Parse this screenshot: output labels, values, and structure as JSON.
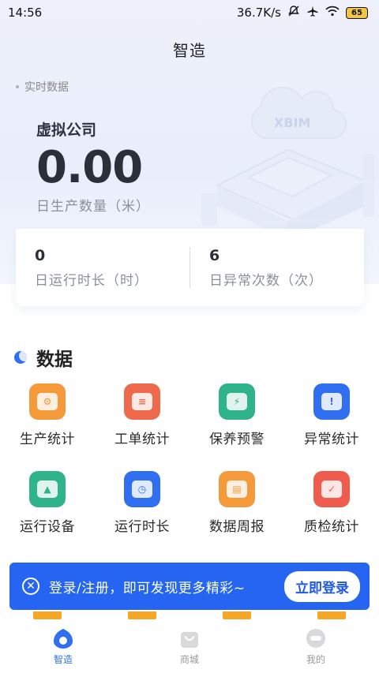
{
  "status_bar": {
    "time": "14:56",
    "network_speed": "36.7K/s",
    "battery": "65"
  },
  "header": {
    "title": "智造"
  },
  "realtime": {
    "section_label": "实时数据",
    "company": "虚拟公司",
    "daily_output_value": "0.00",
    "daily_output_label": "日生产数量（米）",
    "stats": [
      {
        "value": "0",
        "label": "日运行时长（时）"
      },
      {
        "value": "6",
        "label": "日异常次数（次）"
      }
    ],
    "deco_text": "XBIM"
  },
  "data_section": {
    "title": "数据",
    "items": [
      {
        "label": "生产统计",
        "icon": "production-stats-icon",
        "color": "#f59a3b"
      },
      {
        "label": "工单统计",
        "icon": "work-order-icon",
        "color": "#ef6a4c"
      },
      {
        "label": "保养预警",
        "icon": "maintenance-warning-icon",
        "color": "#2fb388"
      },
      {
        "label": "异常统计",
        "icon": "anomaly-stats-icon",
        "color": "#2f6ff0"
      },
      {
        "label": "运行设备",
        "icon": "running-equipment-icon",
        "color": "#2fb388"
      },
      {
        "label": "运行时长",
        "icon": "running-time-icon",
        "color": "#2f6ff0"
      },
      {
        "label": "数据周报",
        "icon": "weekly-report-icon",
        "color": "#f59a3b"
      },
      {
        "label": "质检统计",
        "icon": "quality-inspection-icon",
        "color": "#ef5b4c"
      }
    ]
  },
  "login_banner": {
    "text": "登录/注册，即可发现更多精彩~",
    "button": "立即登录",
    "color": "#2665f2"
  },
  "bottom_nav": [
    {
      "label": "智造",
      "active": true
    },
    {
      "label": "商城",
      "active": false
    },
    {
      "label": "我的",
      "active": false
    }
  ]
}
